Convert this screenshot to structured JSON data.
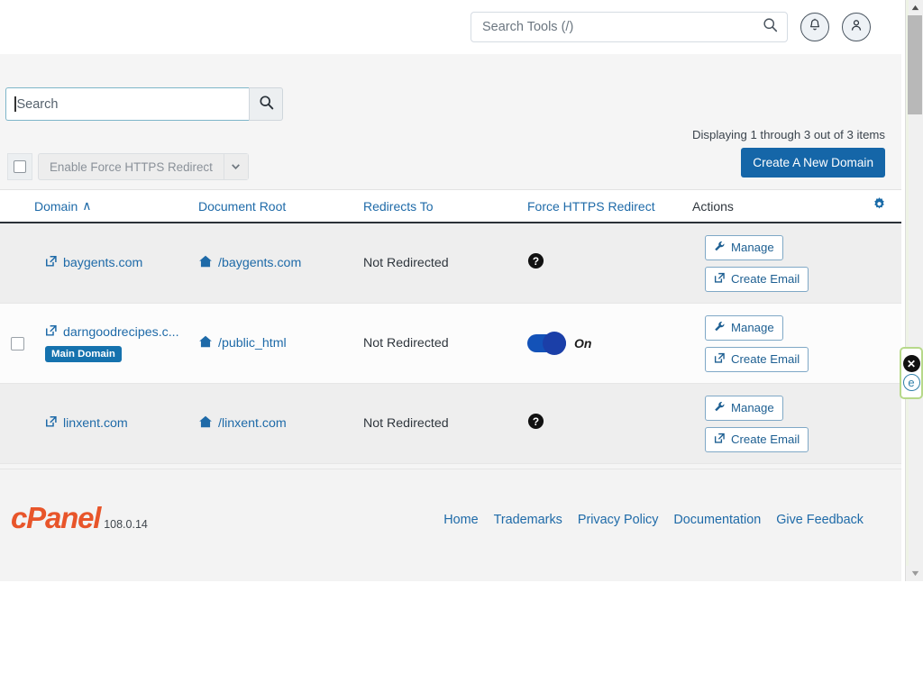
{
  "topbar": {
    "search_placeholder": "Search Tools (/)",
    "search_value": "",
    "search_icon": "search-icon",
    "notifications_icon": "bell-icon",
    "account_icon": "user-icon"
  },
  "toolbar": {
    "search_placeholder": "Search",
    "search_value": "",
    "search_submit_icon": "search-icon",
    "bulk_action_label": "Enable Force HTTPS Redirect",
    "bulk_action_caret": "chevron-down-icon",
    "displaying_text": "Displaying 1 through 3 out of 3 items",
    "create_button_label": "Create A New Domain"
  },
  "annotation": {
    "arrow": "yellow-right-arrow",
    "fill": "#ffe800",
    "stroke": "#000000"
  },
  "table": {
    "columns": [
      {
        "label": "Domain",
        "sort_indicator": "∧",
        "sorted": true
      },
      {
        "label": "Document Root",
        "sort_indicator": "",
        "sorted": false
      },
      {
        "label": "Redirects To",
        "sort_indicator": "",
        "sorted": false
      },
      {
        "label": "Force HTTPS Redirect",
        "sort_indicator": "",
        "sorted": false
      },
      {
        "label": "Actions",
        "sort_indicator": "",
        "sorted": false
      }
    ],
    "settings_icon": "gear-icon",
    "rows": [
      {
        "checkbox": false,
        "domain": "baygents.com",
        "domain_icon": "external-link-icon",
        "badge": "",
        "document_root": "/baygents.com",
        "document_root_icon": "home-icon",
        "redirects_to": "Not Redirected",
        "https_state": "unknown",
        "https_icon": "question-circle-icon",
        "https_label": "",
        "actions": [
          {
            "label": "Manage",
            "icon": "wrench-icon"
          },
          {
            "label": "Create Email",
            "icon": "external-link-icon"
          }
        ]
      },
      {
        "checkbox": true,
        "domain": "darngoodrecipes.c...",
        "domain_icon": "external-link-icon",
        "badge": "Main Domain",
        "document_root": "/public_html",
        "document_root_icon": "home-icon",
        "redirects_to": "Not Redirected",
        "https_state": "on",
        "https_icon": "toggle-switch",
        "https_label": "On",
        "actions": [
          {
            "label": "Manage",
            "icon": "wrench-icon"
          },
          {
            "label": "Create Email",
            "icon": "external-link-icon"
          }
        ]
      },
      {
        "checkbox": false,
        "domain": "linxent.com",
        "domain_icon": "external-link-icon",
        "badge": "",
        "document_root": "/linxent.com",
        "document_root_icon": "home-icon",
        "redirects_to": "Not Redirected",
        "https_state": "unknown",
        "https_icon": "question-circle-icon",
        "https_label": "",
        "actions": [
          {
            "label": "Manage",
            "icon": "wrench-icon"
          },
          {
            "label": "Create Email",
            "icon": "external-link-icon"
          }
        ]
      }
    ]
  },
  "footer": {
    "logo_text": "cPanel",
    "version": "108.0.14",
    "links": [
      "Home",
      "Trademarks",
      "Privacy Policy",
      "Documentation",
      "Give Feedback"
    ]
  },
  "float_widget": {
    "close_label": "✕",
    "badge_label": "e"
  },
  "colors": {
    "brand_orange": "#e8552a",
    "link_blue": "#1e6aa8",
    "primary_button": "#1566a8",
    "toggle_on": "#1352b8",
    "annotation_yellow": "#ffe800"
  }
}
